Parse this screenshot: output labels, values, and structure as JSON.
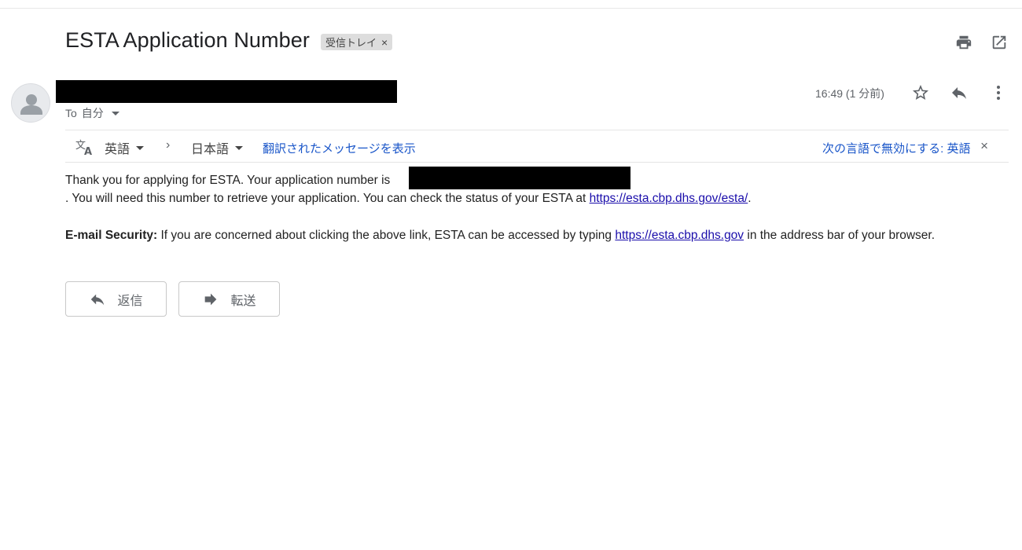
{
  "email": {
    "subject": "ESTA Application Number",
    "label": "受信トレイ",
    "label_close": "×",
    "to_prefix": "To",
    "to_recipient": "自分",
    "time": "16:49 (1 分前)"
  },
  "icons": {
    "print": "print-icon",
    "open_new_window": "open-in-new-window-icon",
    "avatar": "person-icon",
    "star": "star-icon",
    "reply": "reply-icon",
    "more": "more-vertical-icon",
    "translate": "translate-icon",
    "forward": "forward-icon"
  },
  "translation_bar": {
    "source_lang": "英語",
    "arrow": "›",
    "target_lang": "日本語",
    "show_translation": "翻訳されたメッセージを表示",
    "disable_for": "次の言語で無効にする: 英語",
    "close": "×"
  },
  "message": {
    "line1": "Thank you for applying for ESTA. Your application number is",
    "line2_prefix": ". You will need this number to retrieve your application. You can check the status of your ESTA at",
    "line2_link": "https://esta.cbp.dhs.gov/esta/",
    "line2_suffix": ".",
    "security_label": "E-mail Security:",
    "security_text": "If you are concerned about clicking the above link, ESTA can be accessed by typing",
    "security_link": "https://esta.cbp.dhs.gov",
    "security_suffix": "in the address bar of your browser."
  },
  "actions": {
    "reply_label": "返信",
    "forward_label": "転送"
  }
}
